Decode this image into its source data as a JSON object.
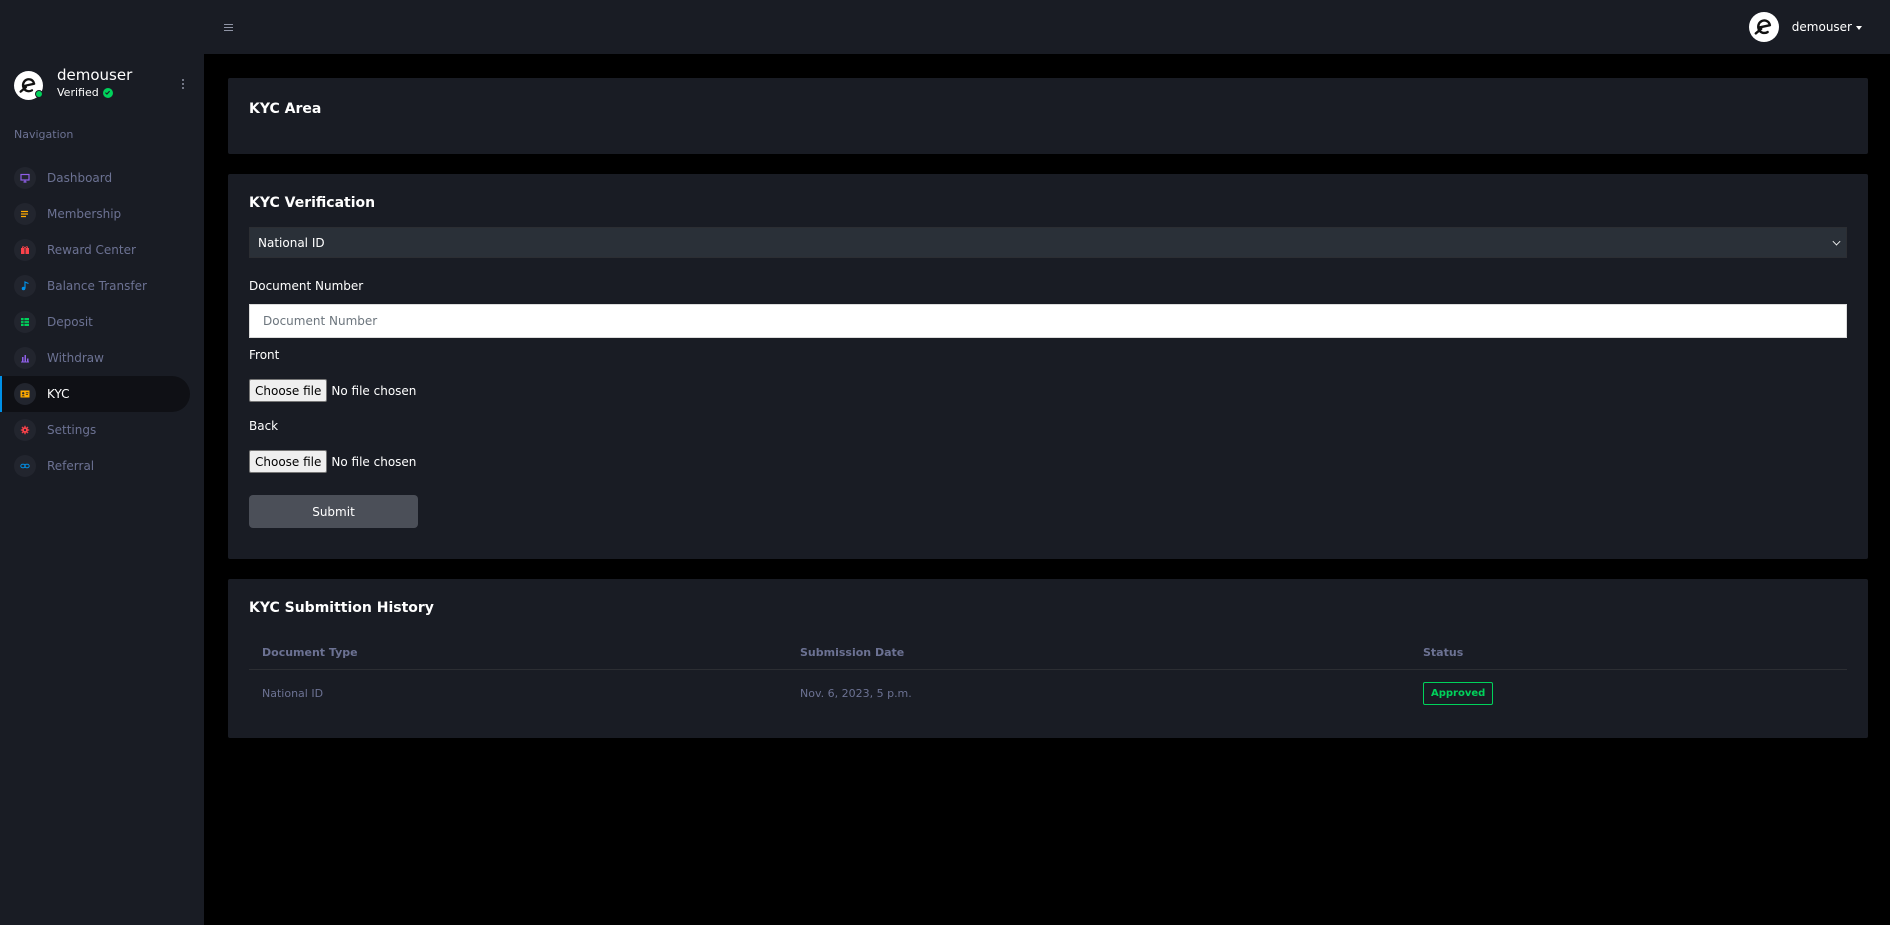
{
  "user": {
    "name": "demouser",
    "status": "Verified"
  },
  "sidebar": {
    "caption": "Navigation",
    "items": [
      {
        "label": "Dashboard",
        "icon": "monitor-icon",
        "color": "#8f5fe8"
      },
      {
        "label": "Membership",
        "icon": "list-icon",
        "color": "#ffab00"
      },
      {
        "label": "Reward Center",
        "icon": "gift-icon",
        "color": "#fc424a"
      },
      {
        "label": "Balance Transfer",
        "icon": "music-note-icon",
        "color": "#0090e7"
      },
      {
        "label": "Deposit",
        "icon": "table-icon",
        "color": "#00d25b"
      },
      {
        "label": "Withdraw",
        "icon": "bar-chart-icon",
        "color": "#8f5fe8"
      },
      {
        "label": "KYC",
        "icon": "id-card-icon",
        "color": "#ffab00"
      },
      {
        "label": "Settings",
        "icon": "gear-icon",
        "color": "#fc424a"
      },
      {
        "label": "Referral",
        "icon": "link-icon",
        "color": "#0090e7"
      }
    ],
    "active_index": 6
  },
  "header": {
    "username": "demouser"
  },
  "kyc_area": {
    "title": "KYC Area"
  },
  "kyc_form": {
    "title": "KYC Verification",
    "document_type": "National ID",
    "document_number_label": "Document Number",
    "document_number_placeholder": "Document Number",
    "document_number_value": "",
    "front_label": "Front",
    "back_label": "Back",
    "choose_file_label": "Choose file",
    "no_file_text": "No file chosen",
    "submit_label": "Submit"
  },
  "history": {
    "title": "KYC Submittion History",
    "columns": [
      "Document Type",
      "Submission Date",
      "Status"
    ],
    "rows": [
      {
        "document_type": "National ID",
        "submission_date": "Nov. 6, 2023, 5 p.m.",
        "status": "Approved"
      }
    ]
  },
  "colors": {
    "sidebar_bg": "#191c24",
    "page_bg": "#000000",
    "accent": "#0090e7",
    "success": "#00d25b",
    "muted_text": "#6c7293"
  }
}
